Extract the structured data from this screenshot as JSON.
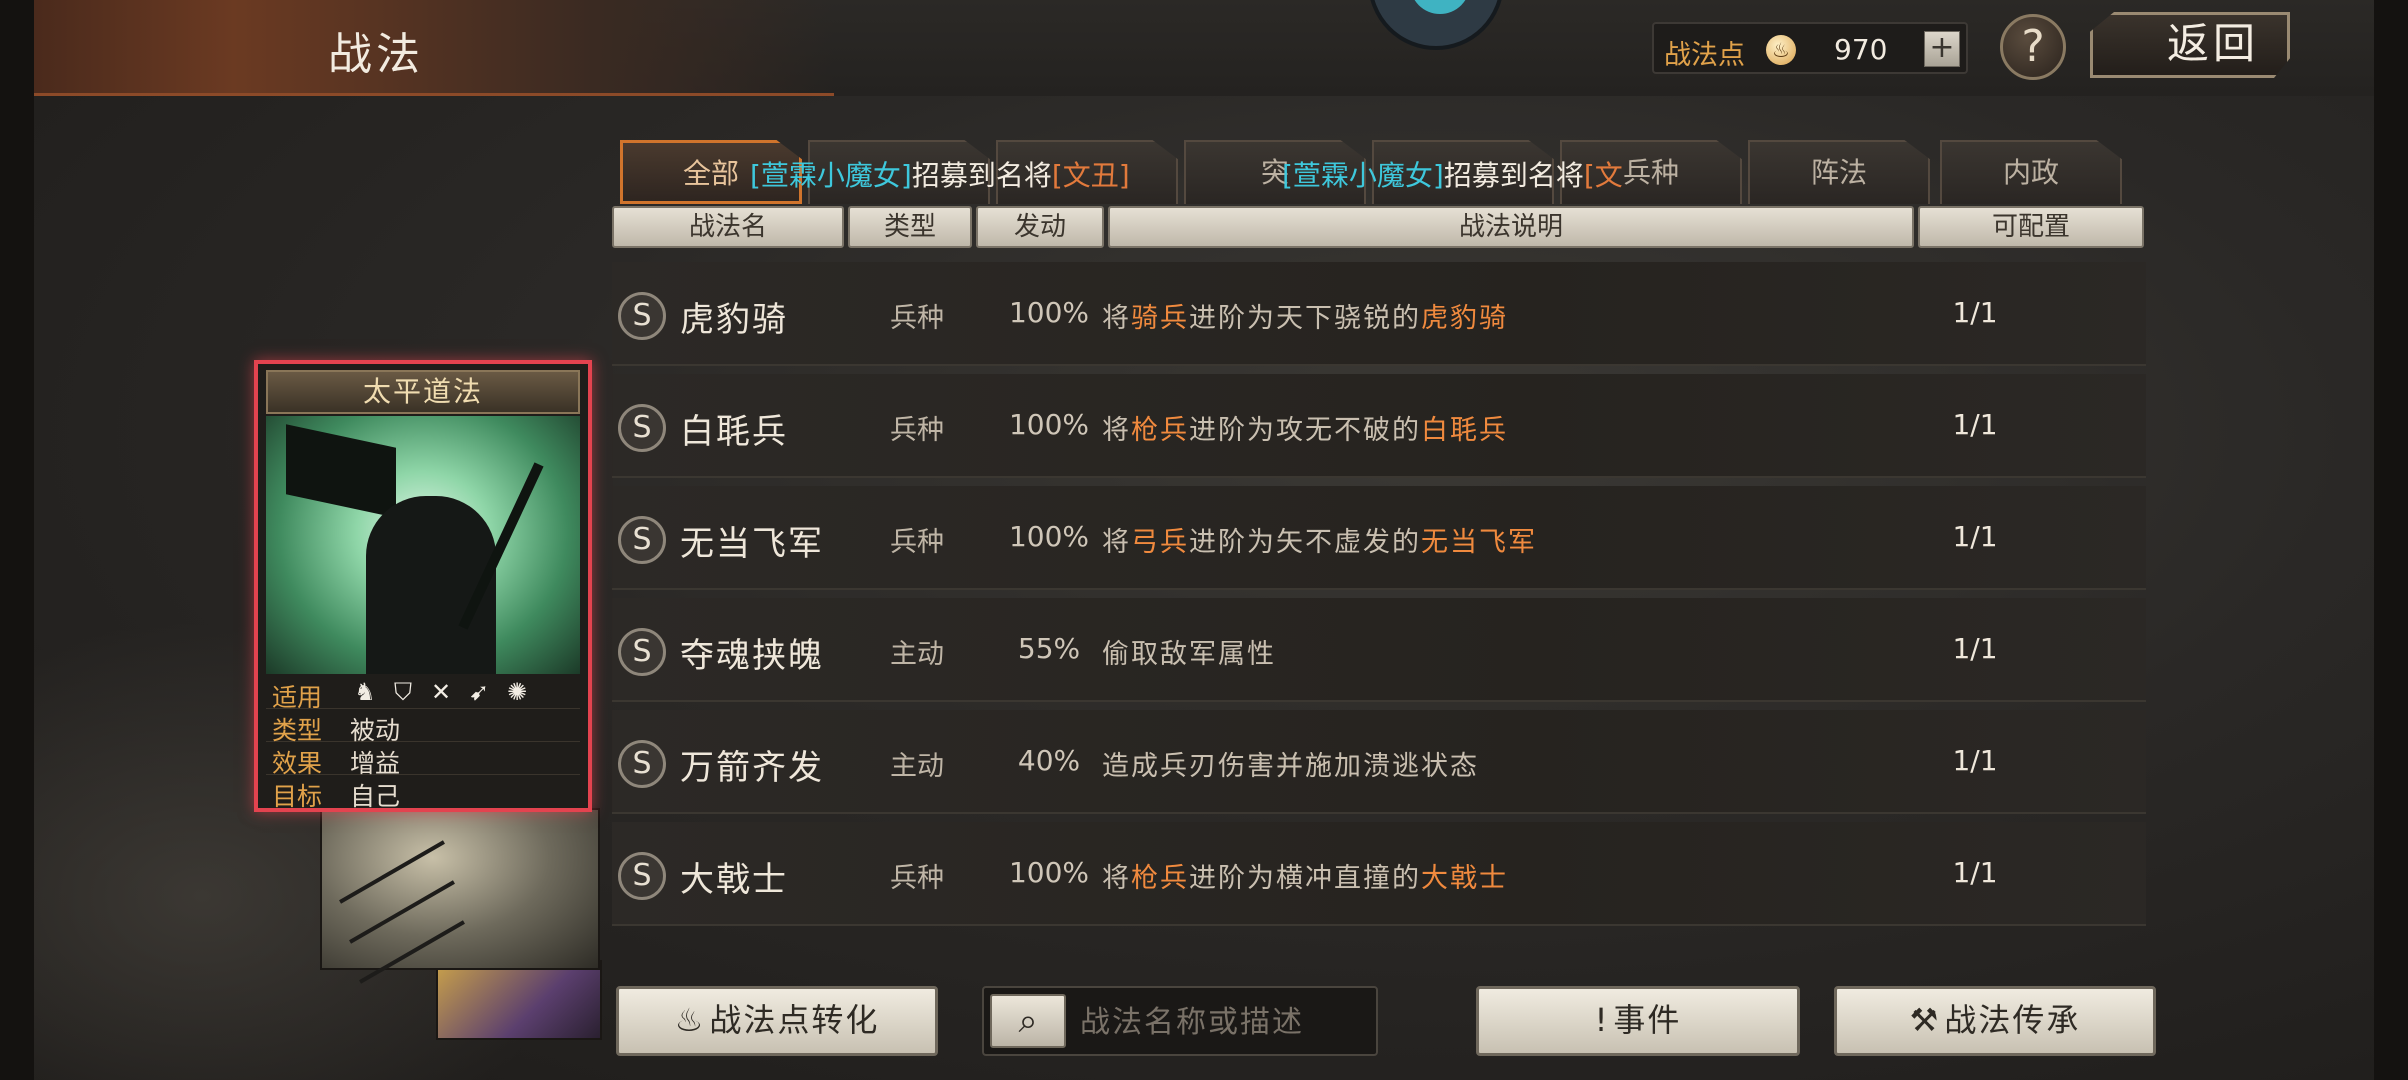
{
  "header": {
    "title": "战法",
    "points_label": "战法点",
    "points_coin": "♨",
    "points_value": "970",
    "plus": "+",
    "help": "?",
    "back": "返回"
  },
  "tabs": [
    {
      "label": "全部",
      "active": true
    },
    {
      "label": "",
      "active": false
    },
    {
      "label": "",
      "active": false
    },
    {
      "label": "突",
      "active": false
    },
    {
      "label": "",
      "active": false
    },
    {
      "label": "兵种",
      "active": false
    },
    {
      "label": "阵法",
      "active": false
    },
    {
      "label": "内政",
      "active": false
    }
  ],
  "announcements": [
    {
      "name": "[萱霖小魔女]",
      "text": "招募到名将",
      "target": "[文丑]"
    },
    {
      "name": "[萱霖小魔女]",
      "text": "招募到名将",
      "target": "[文"
    }
  ],
  "columns": {
    "name": "战法名",
    "type": "类型",
    "rate": "发动",
    "desc": "战法说明",
    "slots": "可配置"
  },
  "skills": [
    {
      "grade": "S",
      "name": "虎豹骑",
      "type": "兵种",
      "rate": "100%",
      "desc_a": "将",
      "desc_b": "骑兵",
      "desc_c": "进阶为天下骁锐的",
      "desc_d": "虎豹骑",
      "slots": "1/1"
    },
    {
      "grade": "S",
      "name": "白毦兵",
      "type": "兵种",
      "rate": "100%",
      "desc_a": "将",
      "desc_b": "枪兵",
      "desc_c": "进阶为攻无不破的",
      "desc_d": "白毦兵",
      "slots": "1/1"
    },
    {
      "grade": "S",
      "name": "无当飞军",
      "type": "兵种",
      "rate": "100%",
      "desc_a": "将",
      "desc_b": "弓兵",
      "desc_c": "进阶为矢不虚发的",
      "desc_d": "无当飞军",
      "slots": "1/1"
    },
    {
      "grade": "S",
      "name": "夺魂挟魄",
      "type": "主动",
      "rate": "55%",
      "desc_a": "偷取敌军属性",
      "desc_b": "",
      "desc_c": "",
      "desc_d": "",
      "slots": "1/1"
    },
    {
      "grade": "S",
      "name": "万箭齐发",
      "type": "主动",
      "rate": "40%",
      "desc_a": "造成兵刃伤害并施加溃逃状态",
      "desc_b": "",
      "desc_c": "",
      "desc_d": "",
      "slots": "1/1"
    },
    {
      "grade": "S",
      "name": "大戟士",
      "type": "兵种",
      "rate": "100%",
      "desc_a": "将",
      "desc_b": "枪兵",
      "desc_c": "进阶为横冲直撞的",
      "desc_d": "大戟士",
      "slots": "1/1"
    }
  ],
  "card": {
    "title": "太平道法",
    "applies_label": "适用",
    "applies_icons": [
      "cavalry-icon",
      "shield-icon",
      "bow-icon",
      "spear-icon",
      "wheel-icon"
    ],
    "type_label": "类型",
    "type_value": "被动",
    "effect_label": "效果",
    "effect_value": "增益",
    "target_label": "目标",
    "target_value": "自己"
  },
  "bottom": {
    "convert_icon": "♨",
    "convert_label": "战法点转化",
    "search_icon": "⌕",
    "search_placeholder": "战法名称或描述",
    "search_value": "",
    "event_icon": "!",
    "event_label": "事件",
    "inherit_icon": "⚒",
    "inherit_label": "战法传承"
  },
  "colors": {
    "highlight": "#f08a3e",
    "announce_name": "#3ec8dc",
    "active_tab": "#d0742c",
    "card_border": "#e3434f"
  }
}
